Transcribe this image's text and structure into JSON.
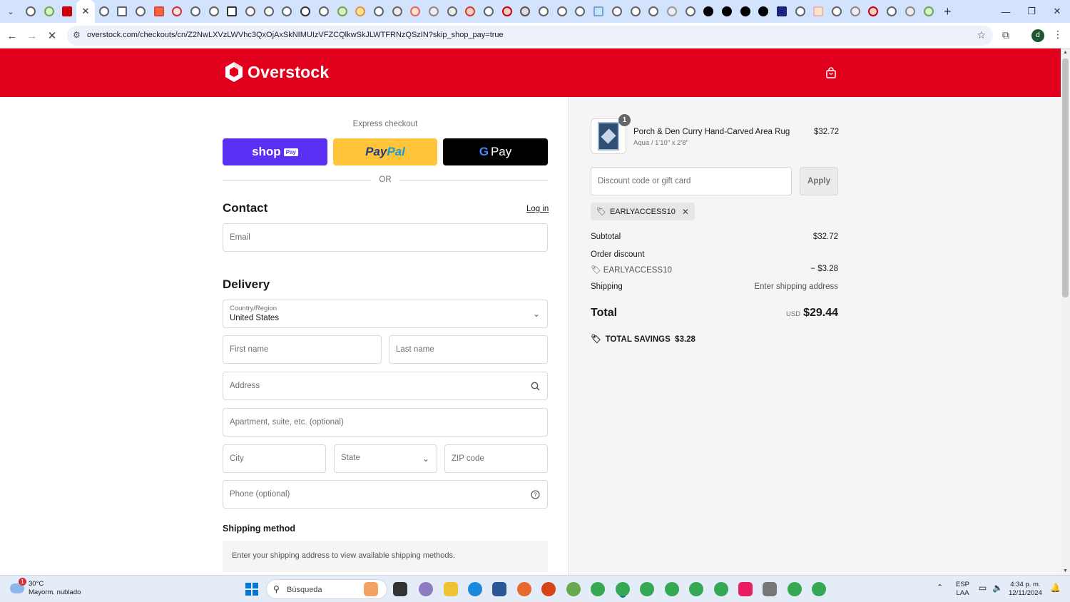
{
  "browser": {
    "active_tab_close": "✕",
    "url": "overstock.com/checkouts/cn/Z2NwLXVzLWVhc3QxOjAxSkNIMUIzVFZCQlkwSkJLWTFRNzQSzIN?skip_shop_pay=true",
    "new_tab_label": "+"
  },
  "header": {
    "brand": "Overstock",
    "colors": {
      "brand_red": "#e0001b"
    }
  },
  "express": {
    "label": "Express checkout",
    "shop_pay": "shop",
    "shop_pay_pill": "Pay",
    "paypal_a": "Pay",
    "paypal_b": "Pal",
    "gpay_g": "G",
    "gpay_text": "Pay",
    "or": "OR"
  },
  "contact": {
    "title": "Contact",
    "login": "Log in",
    "email_placeholder": "Email"
  },
  "delivery": {
    "title": "Delivery",
    "country_label": "Country/Region",
    "country_value": "United States",
    "first_name": "First name",
    "last_name": "Last name",
    "address": "Address",
    "apartment": "Apartment, suite, etc. (optional)",
    "city": "City",
    "state": "State",
    "zip": "ZIP code",
    "phone": "Phone (optional)"
  },
  "shipping": {
    "title": "Shipping method",
    "note": "Enter your shipping address to view available shipping methods."
  },
  "summary": {
    "item": {
      "qty": "1",
      "name": "Porch & Den Curry Hand-Carved Area Rug",
      "variant": "Aqua / 1'10\" x 2'8\"",
      "price": "$32.72"
    },
    "discount_placeholder": "Discount code or gift card",
    "apply": "Apply",
    "code": "EARLYACCESS10",
    "subtotal_label": "Subtotal",
    "subtotal_value": "$32.72",
    "order_discount_label": "Order discount",
    "order_discount_code": "EARLYACCESS10",
    "order_discount_value": "− $3.28",
    "shipping_label": "Shipping",
    "shipping_value": "Enter shipping address",
    "total_label": "Total",
    "total_currency": "USD",
    "total_value": "$29.44",
    "savings_label": "TOTAL SAVINGS",
    "savings_value": "$3.28"
  },
  "taskbar": {
    "weather_badge": "1",
    "temperature": "30°C",
    "condition": "Mayorm. nublado",
    "search": "Búsqueda",
    "lang_1": "ESP",
    "lang_2": "LAA",
    "time": "4:34 p. m.",
    "date": "12/11/2024"
  }
}
